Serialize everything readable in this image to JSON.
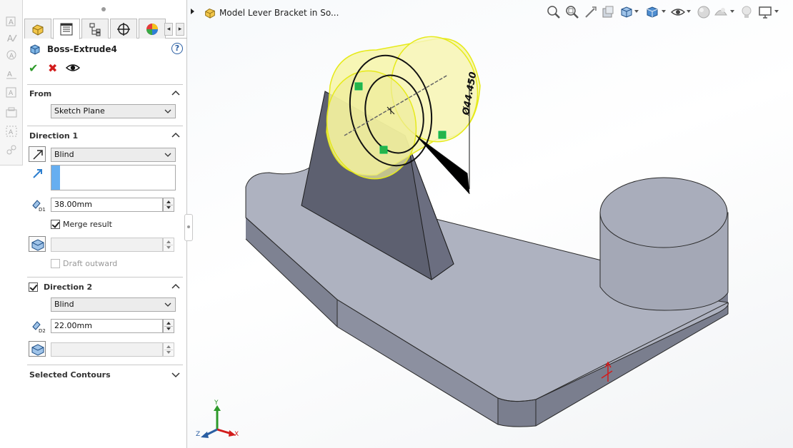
{
  "left_strip": {
    "icons": [
      "smart-dimension-icon",
      "note-icon",
      "balloon-icon",
      "surface-finish-icon",
      "datum-icon",
      "weld-symbol-icon",
      "hole-callout-icon",
      "center-mark-icon"
    ]
  },
  "property_manager": {
    "tabs": [
      {
        "name": "feature-manager",
        "icon": "part-icon"
      },
      {
        "name": "property-manager",
        "icon": "property-list-icon"
      },
      {
        "name": "configuration-manager",
        "icon": "configuration-icon"
      },
      {
        "name": "dimxpert-manager",
        "icon": "crosshair-icon"
      },
      {
        "name": "display-manager",
        "icon": "appearance-pie-icon"
      }
    ],
    "title": "Boss-Extrude4",
    "help": "?",
    "from": {
      "label": "From",
      "value": "Sketch Plane"
    },
    "direction1": {
      "label": "Direction 1",
      "end_condition": "Blind",
      "depth": "38.00mm",
      "merge_result": {
        "label": "Merge result",
        "checked": true
      },
      "draft_value": "",
      "draft_outward": {
        "label": "Draft outward",
        "checked": false,
        "enabled": false
      }
    },
    "direction2": {
      "label": "Direction 2",
      "checked": true,
      "end_condition": "Blind",
      "depth": "22.00mm",
      "draft_value": ""
    },
    "selected_contours": {
      "label": "Selected Contours"
    },
    "depth_icon_labels": {
      "d1": "D1",
      "d2": "D2"
    }
  },
  "graphics": {
    "tree_title": "Model Lever Bracket in So...",
    "dimension": "Ø44.450",
    "hud_icons": [
      "zoom-to-fit-icon",
      "zoom-to-area-icon",
      "previous-view-icon",
      "section-view-icon",
      "view-orientation-icon",
      "display-style-icon",
      "hide-show-items-icon",
      "edit-appearance-icon",
      "apply-scene-icon",
      "view-settings-icon",
      "display-monitor-icon"
    ],
    "triad": {
      "x": "X",
      "y": "Y",
      "z": "Z"
    }
  },
  "colors": {
    "model_face_top": "#aeb2c0",
    "model_face_side": "#868a99",
    "model_face_dark": "#5d6070",
    "preview_yellow": "#f6f4a8",
    "preview_edge": "#e6ea1a",
    "accept_green": "#2e9a2a",
    "cancel_red": "#d21c1c",
    "stripe_blue": "#66aef0"
  }
}
